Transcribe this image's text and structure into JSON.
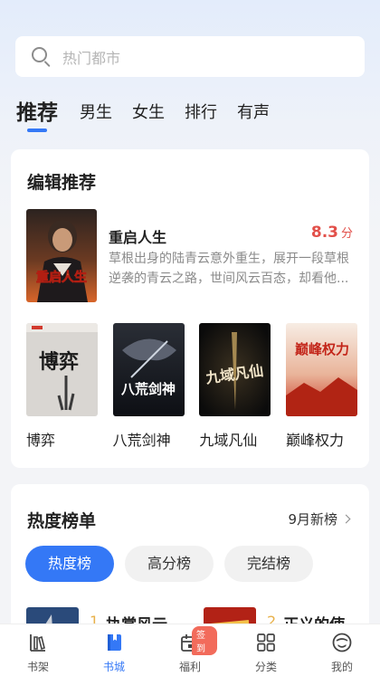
{
  "search": {
    "placeholder": "热门都市"
  },
  "tabs": [
    {
      "label": "推荐",
      "active": true
    },
    {
      "label": "男生"
    },
    {
      "label": "女生"
    },
    {
      "label": "排行"
    },
    {
      "label": "有声"
    }
  ],
  "editor_pick": {
    "title": "编辑推荐",
    "featured": {
      "cover_text": "重启人生",
      "title": "重启人生",
      "score": "8.3",
      "score_unit": "分",
      "description": "草根出身的陆青云意外重生，展开一段草根逆袭的青云之路，世间风云百态，却看他..."
    },
    "books": [
      {
        "title": "博弈",
        "cover_text": "博弈"
      },
      {
        "title": "八荒剑神",
        "cover_text": "八荒剑神"
      },
      {
        "title": "九域凡仙",
        "cover_text": "九域凡仙"
      },
      {
        "title": "巅峰权力",
        "cover_text": "巅峰权力"
      }
    ]
  },
  "ranking": {
    "title": "热度榜单",
    "new_list_label": "9月新榜",
    "pills": [
      {
        "label": "热度榜",
        "active": true
      },
      {
        "label": "高分榜"
      },
      {
        "label": "完结榜"
      }
    ],
    "items": [
      {
        "rank": "1",
        "title": "执掌风云"
      },
      {
        "rank": "2",
        "title": "正义的使"
      }
    ]
  },
  "bottom_nav": [
    {
      "label": "书架",
      "icon": "bookshelf-icon"
    },
    {
      "label": "书城",
      "icon": "book-store-icon",
      "active": true
    },
    {
      "label": "福利",
      "icon": "gift-calendar-icon",
      "badge": "签到"
    },
    {
      "label": "分类",
      "icon": "category-grid-icon"
    },
    {
      "label": "我的",
      "icon": "profile-icon"
    }
  ],
  "colors": {
    "accent": "#3478f6",
    "score": "#e2504a",
    "rank": "#e8b14a",
    "badge": "#f26b5b"
  }
}
